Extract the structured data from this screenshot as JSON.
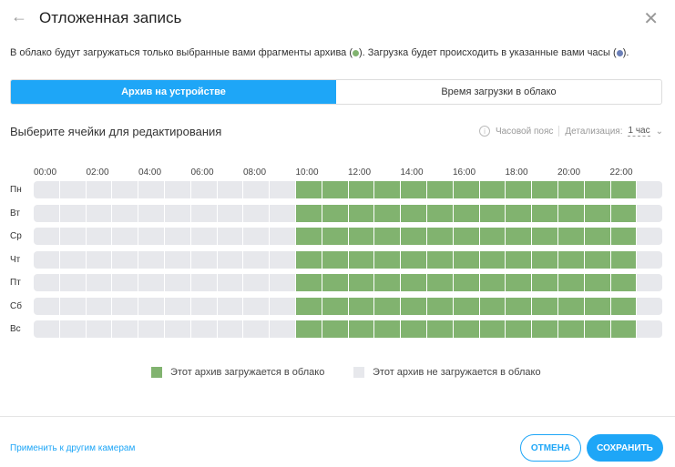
{
  "header": {
    "title": "Отложенная запись"
  },
  "description": {
    "part1": "В облако будут загружаться только выбранные вами фрагменты архива (",
    "part2": "). Загрузка будет происходить в указанные вами часы (",
    "part3": ").",
    "green": "#81b36f",
    "blue": "#6a7fb8"
  },
  "tabs": [
    {
      "label": "Архив на устройстве",
      "active": true
    },
    {
      "label": "Время загрузки в облако",
      "active": false
    }
  ],
  "section": {
    "title": "Выберите ячейки для редактирования",
    "timezone": "Часовой пояс",
    "detail_label": "Детализация:",
    "detail_value": "1 час"
  },
  "schedule": {
    "hours": [
      "00:00",
      "02:00",
      "04:00",
      "06:00",
      "08:00",
      "10:00",
      "12:00",
      "14:00",
      "16:00",
      "18:00",
      "20:00",
      "22:00"
    ],
    "days": [
      "Пн",
      "Вт",
      "Ср",
      "Чт",
      "Пт",
      "Сб",
      "Вс"
    ],
    "enabled_hours": [
      10,
      11,
      12,
      13,
      14,
      15,
      16,
      17,
      18,
      19,
      20,
      21,
      22
    ]
  },
  "legend": {
    "on": "Этот архив загружается в облако",
    "off": "Этот архив не загружается в облако"
  },
  "footer": {
    "apply": "Применить к другим камерам",
    "cancel": "ОТМЕНА",
    "save": "СОХРАНИТЬ"
  }
}
